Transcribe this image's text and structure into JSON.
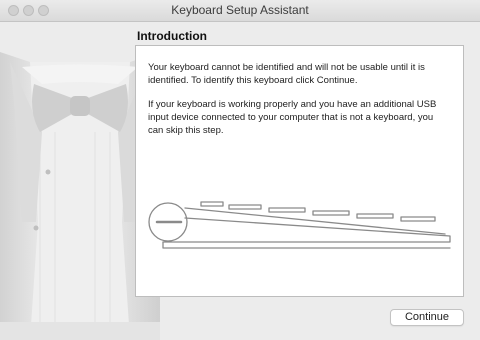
{
  "window": {
    "title": "Keyboard Setup Assistant",
    "traffic_lights": [
      "close",
      "minimize",
      "zoom"
    ]
  },
  "sidebar_art": {
    "icon": "tuxedo-bowtie-illustration"
  },
  "main": {
    "heading": "Introduction",
    "paragraphs": [
      "Your keyboard cannot be identified and will not be usable until it is identified. To identify this keyboard click Continue.",
      "If your keyboard is working properly and you have an additional USB input device connected to your computer that is not a keyboard, you can skip this step."
    ],
    "illustration": {
      "icon": "keyboard-outline-icon"
    }
  },
  "footer": {
    "continue_label": "Continue"
  },
  "colors": {
    "window_bg": "#ececec",
    "panel_bg": "#ffffff",
    "panel_border": "#bdbdbd",
    "text": "#222222"
  }
}
